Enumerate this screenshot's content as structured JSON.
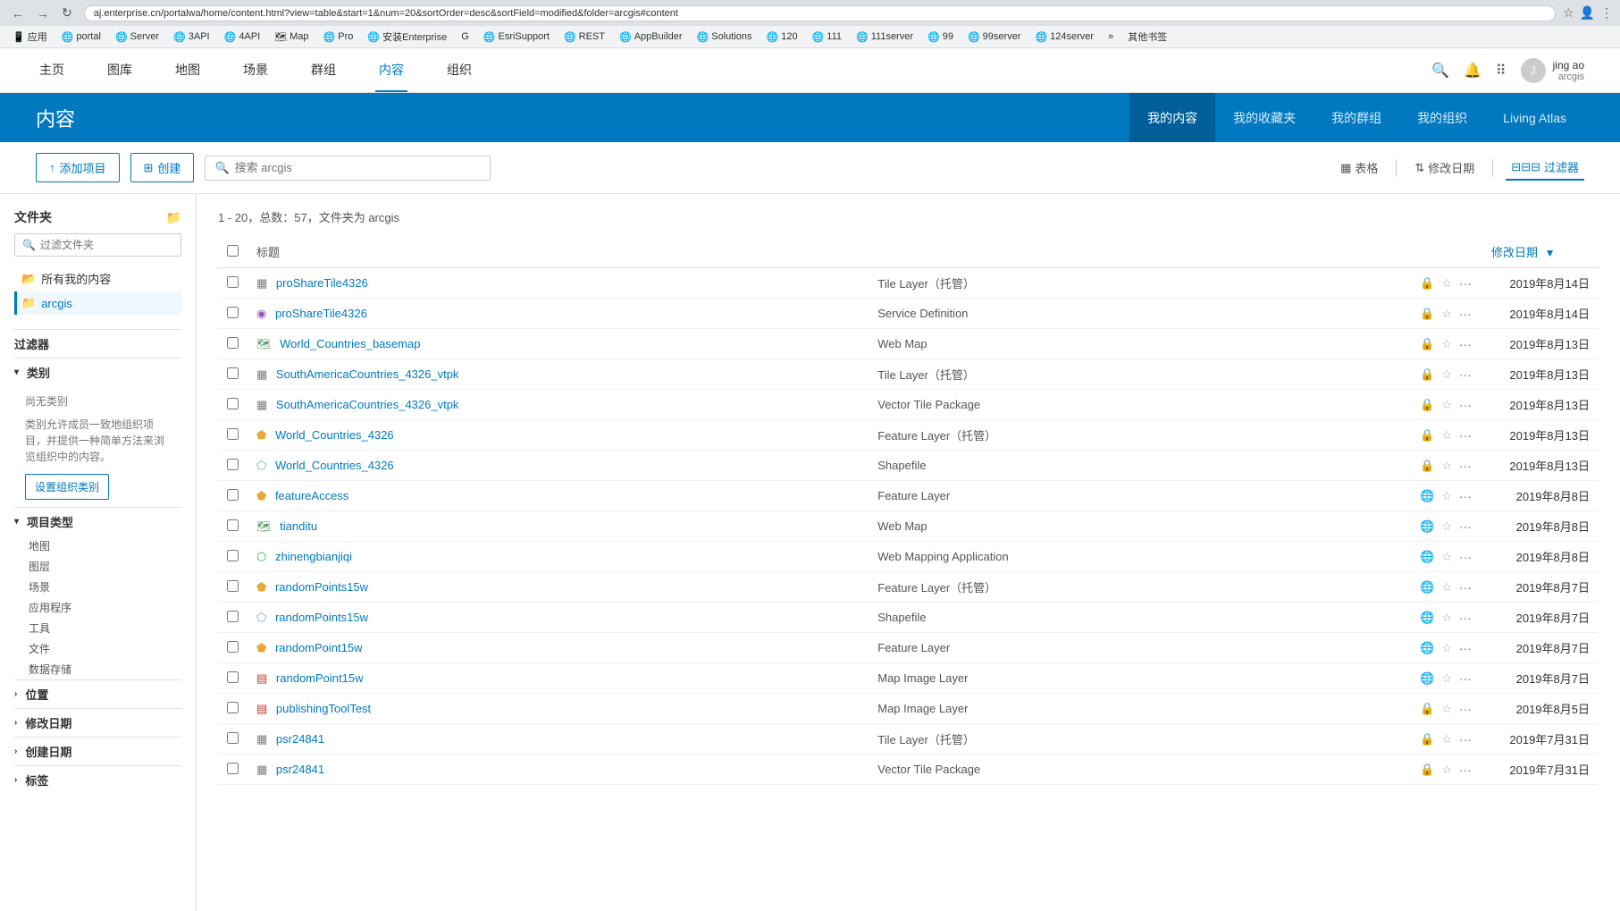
{
  "browser": {
    "url": "aj.enterprise.cn/portalwa/home/content.html?view=table&start=1&num=20&sortOrder=desc&sortField=modified&folder=arcgis#content",
    "nav": [
      "←",
      "→",
      "↻"
    ],
    "bookmarks": [
      "应用",
      "portal",
      "Server",
      "3API",
      "4API",
      "Map",
      "Pro",
      "安装Enterprise",
      "G",
      "EsriSupport",
      "REST",
      "AppBuilder",
      "Solutions",
      "120",
      "111",
      "111server",
      "99",
      "99server",
      "124server"
    ],
    "overflow": "»",
    "other_bookmarks": "其他书签"
  },
  "top_nav": {
    "items": [
      "主页",
      "图库",
      "地图",
      "场景",
      "群组",
      "内容",
      "组织"
    ],
    "active": "内容",
    "user_name": "jing ao",
    "user_org": "arcgis"
  },
  "content_header": {
    "title": "内容",
    "tabs": [
      "我的内容",
      "我的收藏夹",
      "我的群组",
      "我的组织",
      "Living Atlas"
    ],
    "active_tab": "我的内容"
  },
  "toolbar": {
    "add_item_label": "↑ 添加项目",
    "create_label": "⊞ 创建",
    "search_placeholder": "搜索 arcgis",
    "view_table_label": "表格",
    "modified_label": "修改日期",
    "filter_label": "过滤器"
  },
  "sidebar": {
    "folders_title": "文件夹",
    "folder_filter_placeholder": "过滤文件夹",
    "all_my_content": "所有我的内容",
    "arcgis_folder": "arcgis",
    "filters_title": "过滤器",
    "category_section": {
      "label": "类别",
      "empty_label": "尚无类别",
      "description": "类别允许成员一致地组织项目，并提供一种简单方法来浏览组织中的内容。",
      "set_button": "设置组织类别"
    },
    "item_type_section": {
      "label": "项目类型",
      "items": [
        "地图",
        "图层",
        "场景",
        "应用程序",
        "工具",
        "文件",
        "数据存储"
      ]
    },
    "location_section": {
      "label": "位置"
    },
    "modified_date_section": {
      "label": "修改日期"
    },
    "created_date_section": {
      "label": "创建日期"
    },
    "tags_section": {
      "label": "标签"
    }
  },
  "content": {
    "summary": "1 - 20，总数：57，文件夹为 arcgis",
    "col_title": "标题",
    "col_modified": "修改日期",
    "items": [
      {
        "id": 1,
        "name": "proShareTile4326",
        "type": "Tile Layer（托管）",
        "icon_type": "tile",
        "lock": true,
        "date": "2019年8月14日"
      },
      {
        "id": 2,
        "name": "proShareTile4326",
        "type": "Service Definition",
        "icon_type": "service",
        "lock": true,
        "date": "2019年8月14日"
      },
      {
        "id": 3,
        "name": "World_Countries_basemap",
        "type": "Web Map",
        "icon_type": "webmap",
        "lock": true,
        "date": "2019年8月13日"
      },
      {
        "id": 4,
        "name": "SouthAmericaCountries_4326_vtpk",
        "type": "Tile Layer（托管）",
        "icon_type": "tile",
        "lock": true,
        "date": "2019年8月13日"
      },
      {
        "id": 5,
        "name": "SouthAmericaCountries_4326_vtpk",
        "type": "Vector Tile Package",
        "icon_type": "tile",
        "lock": true,
        "date": "2019年8月13日"
      },
      {
        "id": 6,
        "name": "World_Countries_4326",
        "type": "Feature Layer（托管）",
        "icon_type": "feature",
        "lock": true,
        "date": "2019年8月13日"
      },
      {
        "id": 7,
        "name": "World_Countries_4326",
        "type": "Shapefile",
        "icon_type": "shapefile",
        "lock": true,
        "date": "2019年8月13日"
      },
      {
        "id": 8,
        "name": "featureAccess",
        "type": "Feature Layer",
        "icon_type": "feature",
        "lock": false,
        "date": "2019年8月8日"
      },
      {
        "id": 9,
        "name": "tianditu",
        "type": "Web Map",
        "icon_type": "webmap",
        "lock": false,
        "date": "2019年8月8日"
      },
      {
        "id": 10,
        "name": "zhinengbianjiqi",
        "type": "Web Mapping Application",
        "icon_type": "webapp",
        "lock": false,
        "date": "2019年8月8日"
      },
      {
        "id": 11,
        "name": "randomPoints15w",
        "type": "Feature Layer（托管）",
        "icon_type": "feature",
        "lock": false,
        "date": "2019年8月7日"
      },
      {
        "id": 12,
        "name": "randomPoints15w",
        "type": "Shapefile",
        "icon_type": "shapefile",
        "lock": false,
        "date": "2019年8月7日"
      },
      {
        "id": 13,
        "name": "randomPoint15w",
        "type": "Feature Layer",
        "icon_type": "feature",
        "lock": false,
        "date": "2019年8月7日"
      },
      {
        "id": 14,
        "name": "randomPoint15w",
        "type": "Map Image Layer",
        "icon_type": "map-image",
        "lock": false,
        "date": "2019年8月7日"
      },
      {
        "id": 15,
        "name": "publishingToolTest",
        "type": "Map Image Layer",
        "icon_type": "map-image",
        "lock": true,
        "date": "2019年8月5日"
      },
      {
        "id": 16,
        "name": "psr24841",
        "type": "Tile Layer（托管）",
        "icon_type": "tile",
        "lock": true,
        "date": "2019年7月31日"
      },
      {
        "id": 17,
        "name": "psr24841",
        "type": "Vector Tile Package",
        "icon_type": "tile",
        "lock": true,
        "date": "2019年7月31日"
      }
    ]
  },
  "icons": {
    "search": "🔍",
    "bell": "🔔",
    "grid": "⠿",
    "chevron_down": "▼",
    "chevron_right": "›",
    "chevron_left": "‹",
    "lock": "🔒",
    "globe": "🌐",
    "star": "☆",
    "more": "···",
    "folder": "📁",
    "folder_open": "📂",
    "table_icon": "▦",
    "filter_icon": "⊟",
    "sort_icon": "⇅"
  },
  "colors": {
    "primary": "#0079c1",
    "header_bg": "#0079c1",
    "active_tab": "#005e99",
    "link": "#0079c1"
  }
}
